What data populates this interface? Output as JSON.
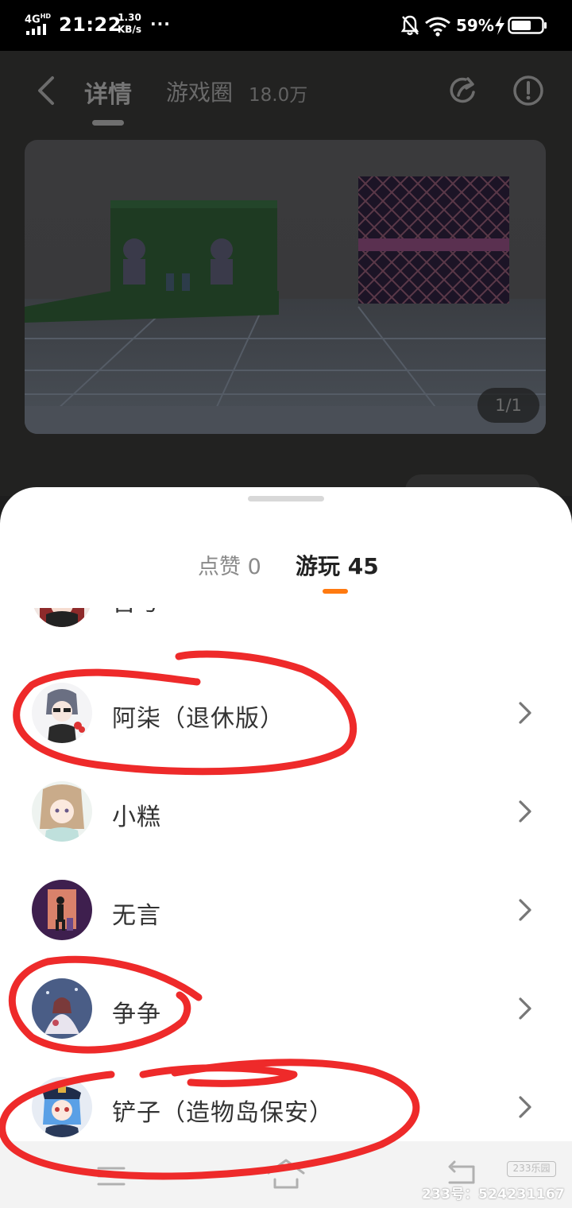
{
  "status_bar": {
    "network": "4G",
    "network_sup": "HD",
    "time": "21:22",
    "speed_value": "1.30",
    "speed_unit": "KB/s",
    "more": "···",
    "battery": "59%",
    "icons": [
      "signal-icon",
      "bell-off-icon",
      "wifi-icon",
      "charging-icon",
      "battery-icon"
    ]
  },
  "header": {
    "back_icon": "chevron-left-icon",
    "tabs": [
      {
        "label": "详情",
        "active": true
      },
      {
        "label": "游戏圈",
        "count": "18.0万",
        "active": false
      }
    ],
    "share_icon": "share-icon",
    "info_icon": "info-icon"
  },
  "banner": {
    "pager": "1/1"
  },
  "sheet": {
    "tabs": [
      {
        "label": "点赞 0",
        "active": false
      },
      {
        "label": "游玩 45",
        "active": true
      }
    ],
    "accent_color": "#ff7a10",
    "users": [
      {
        "name": "吉兮",
        "partial": true
      },
      {
        "name": "阿柒（退休版）"
      },
      {
        "name": "小糕"
      },
      {
        "name": "无言"
      },
      {
        "name": "争争"
      },
      {
        "name": "铲子（造物岛保安）"
      }
    ]
  },
  "nav_bar": {
    "icons": [
      "menu-icon",
      "home-icon",
      "back-icon"
    ]
  },
  "watermark": {
    "logo": "233乐园",
    "text": "233号：524231167"
  },
  "annotation_color": "#ee2a2a"
}
